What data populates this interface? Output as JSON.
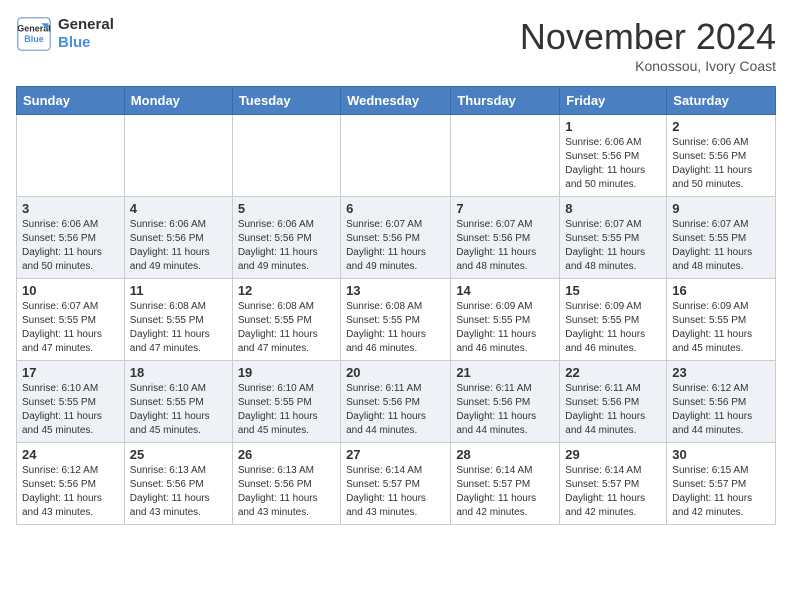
{
  "header": {
    "logo_line1": "General",
    "logo_line2": "Blue",
    "month": "November 2024",
    "location": "Konossou, Ivory Coast"
  },
  "days_of_week": [
    "Sunday",
    "Monday",
    "Tuesday",
    "Wednesday",
    "Thursday",
    "Friday",
    "Saturday"
  ],
  "weeks": [
    [
      {
        "day": "",
        "info": ""
      },
      {
        "day": "",
        "info": ""
      },
      {
        "day": "",
        "info": ""
      },
      {
        "day": "",
        "info": ""
      },
      {
        "day": "",
        "info": ""
      },
      {
        "day": "1",
        "info": "Sunrise: 6:06 AM\nSunset: 5:56 PM\nDaylight: 11 hours\nand 50 minutes."
      },
      {
        "day": "2",
        "info": "Sunrise: 6:06 AM\nSunset: 5:56 PM\nDaylight: 11 hours\nand 50 minutes."
      }
    ],
    [
      {
        "day": "3",
        "info": "Sunrise: 6:06 AM\nSunset: 5:56 PM\nDaylight: 11 hours\nand 50 minutes."
      },
      {
        "day": "4",
        "info": "Sunrise: 6:06 AM\nSunset: 5:56 PM\nDaylight: 11 hours\nand 49 minutes."
      },
      {
        "day": "5",
        "info": "Sunrise: 6:06 AM\nSunset: 5:56 PM\nDaylight: 11 hours\nand 49 minutes."
      },
      {
        "day": "6",
        "info": "Sunrise: 6:07 AM\nSunset: 5:56 PM\nDaylight: 11 hours\nand 49 minutes."
      },
      {
        "day": "7",
        "info": "Sunrise: 6:07 AM\nSunset: 5:56 PM\nDaylight: 11 hours\nand 48 minutes."
      },
      {
        "day": "8",
        "info": "Sunrise: 6:07 AM\nSunset: 5:55 PM\nDaylight: 11 hours\nand 48 minutes."
      },
      {
        "day": "9",
        "info": "Sunrise: 6:07 AM\nSunset: 5:55 PM\nDaylight: 11 hours\nand 48 minutes."
      }
    ],
    [
      {
        "day": "10",
        "info": "Sunrise: 6:07 AM\nSunset: 5:55 PM\nDaylight: 11 hours\nand 47 minutes."
      },
      {
        "day": "11",
        "info": "Sunrise: 6:08 AM\nSunset: 5:55 PM\nDaylight: 11 hours\nand 47 minutes."
      },
      {
        "day": "12",
        "info": "Sunrise: 6:08 AM\nSunset: 5:55 PM\nDaylight: 11 hours\nand 47 minutes."
      },
      {
        "day": "13",
        "info": "Sunrise: 6:08 AM\nSunset: 5:55 PM\nDaylight: 11 hours\nand 46 minutes."
      },
      {
        "day": "14",
        "info": "Sunrise: 6:09 AM\nSunset: 5:55 PM\nDaylight: 11 hours\nand 46 minutes."
      },
      {
        "day": "15",
        "info": "Sunrise: 6:09 AM\nSunset: 5:55 PM\nDaylight: 11 hours\nand 46 minutes."
      },
      {
        "day": "16",
        "info": "Sunrise: 6:09 AM\nSunset: 5:55 PM\nDaylight: 11 hours\nand 45 minutes."
      }
    ],
    [
      {
        "day": "17",
        "info": "Sunrise: 6:10 AM\nSunset: 5:55 PM\nDaylight: 11 hours\nand 45 minutes."
      },
      {
        "day": "18",
        "info": "Sunrise: 6:10 AM\nSunset: 5:55 PM\nDaylight: 11 hours\nand 45 minutes."
      },
      {
        "day": "19",
        "info": "Sunrise: 6:10 AM\nSunset: 5:55 PM\nDaylight: 11 hours\nand 45 minutes."
      },
      {
        "day": "20",
        "info": "Sunrise: 6:11 AM\nSunset: 5:56 PM\nDaylight: 11 hours\nand 44 minutes."
      },
      {
        "day": "21",
        "info": "Sunrise: 6:11 AM\nSunset: 5:56 PM\nDaylight: 11 hours\nand 44 minutes."
      },
      {
        "day": "22",
        "info": "Sunrise: 6:11 AM\nSunset: 5:56 PM\nDaylight: 11 hours\nand 44 minutes."
      },
      {
        "day": "23",
        "info": "Sunrise: 6:12 AM\nSunset: 5:56 PM\nDaylight: 11 hours\nand 44 minutes."
      }
    ],
    [
      {
        "day": "24",
        "info": "Sunrise: 6:12 AM\nSunset: 5:56 PM\nDaylight: 11 hours\nand 43 minutes."
      },
      {
        "day": "25",
        "info": "Sunrise: 6:13 AM\nSunset: 5:56 PM\nDaylight: 11 hours\nand 43 minutes."
      },
      {
        "day": "26",
        "info": "Sunrise: 6:13 AM\nSunset: 5:56 PM\nDaylight: 11 hours\nand 43 minutes."
      },
      {
        "day": "27",
        "info": "Sunrise: 6:14 AM\nSunset: 5:57 PM\nDaylight: 11 hours\nand 43 minutes."
      },
      {
        "day": "28",
        "info": "Sunrise: 6:14 AM\nSunset: 5:57 PM\nDaylight: 11 hours\nand 42 minutes."
      },
      {
        "day": "29",
        "info": "Sunrise: 6:14 AM\nSunset: 5:57 PM\nDaylight: 11 hours\nand 42 minutes."
      },
      {
        "day": "30",
        "info": "Sunrise: 6:15 AM\nSunset: 5:57 PM\nDaylight: 11 hours\nand 42 minutes."
      }
    ]
  ]
}
